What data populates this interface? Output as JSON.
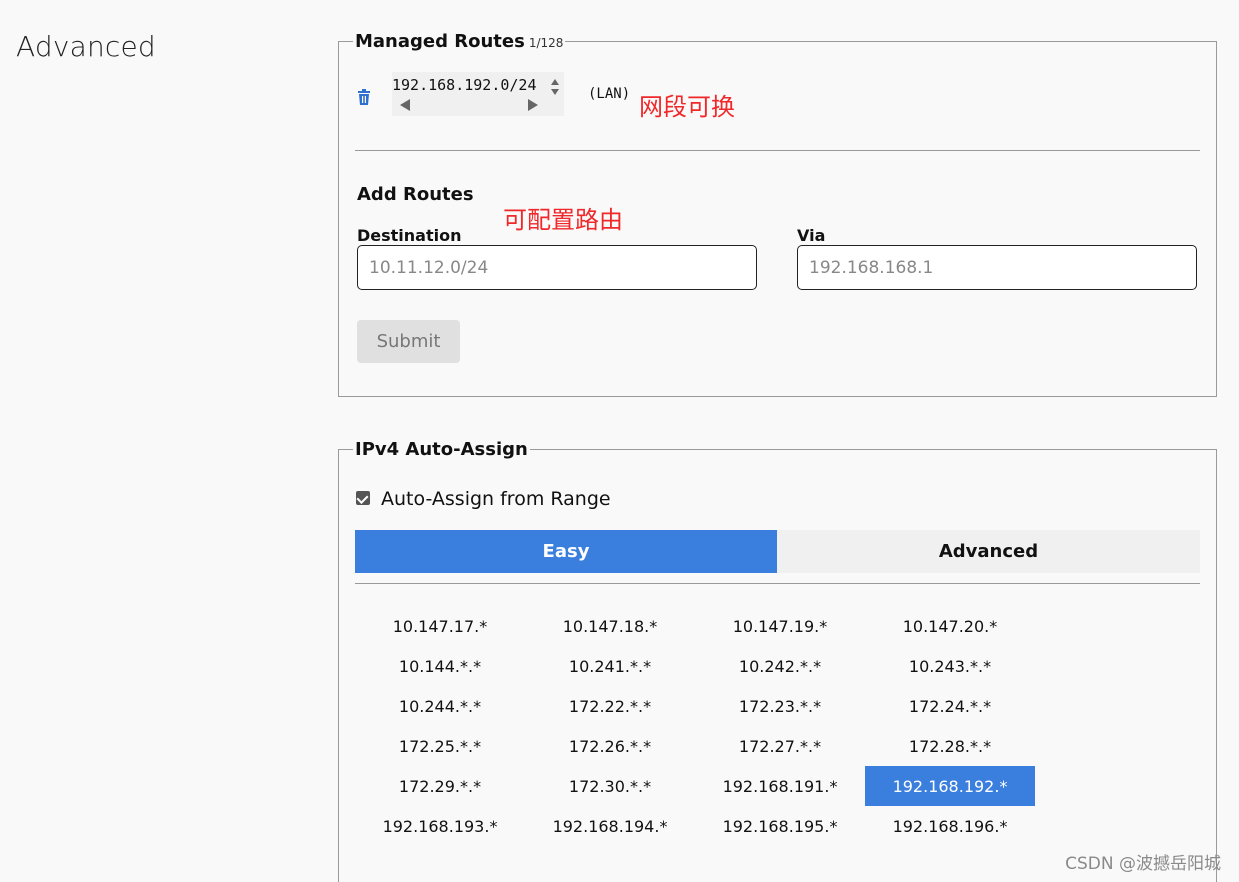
{
  "section_title": "Advanced",
  "managed_routes": {
    "legend": "Managed Routes",
    "count": "1/128",
    "route_value": "192.168.192.0/24",
    "route_tag": "(LAN)",
    "annotation": "网段可换"
  },
  "add_routes": {
    "title": "Add Routes",
    "annotation": "可配置路由",
    "destination_label": "Destination",
    "destination_placeholder": "10.11.12.0/24",
    "via_label": "Via",
    "via_placeholder": "192.168.168.1",
    "submit_label": "Submit"
  },
  "ipv4": {
    "legend": "IPv4 Auto-Assign",
    "checkbox_label": "Auto-Assign from Range",
    "checkbox_checked": true,
    "tabs": [
      {
        "label": "Easy",
        "active": true
      },
      {
        "label": "Advanced",
        "active": false
      }
    ],
    "ranges": [
      "10.147.17.*",
      "10.147.18.*",
      "10.147.19.*",
      "10.147.20.*",
      "10.144.*.*",
      "10.241.*.*",
      "10.242.*.*",
      "10.243.*.*",
      "10.244.*.*",
      "172.22.*.*",
      "172.23.*.*",
      "172.24.*.*",
      "172.25.*.*",
      "172.26.*.*",
      "172.27.*.*",
      "172.28.*.*",
      "172.29.*.*",
      "172.30.*.*",
      "192.168.191.*",
      "192.168.192.*",
      "192.168.193.*",
      "192.168.194.*",
      "192.168.195.*",
      "192.168.196.*"
    ],
    "selected_range": "192.168.192.*"
  },
  "watermark": "CSDN @波撼岳阳城",
  "colors": {
    "accent": "#3a7fde",
    "annotation": "#f0282a",
    "trash_icon": "#2f6fd0"
  },
  "icons": {
    "delete": "trash-icon",
    "spinner": "spinner-arrows-icon",
    "checkbox": "checkbox-checked-icon"
  }
}
